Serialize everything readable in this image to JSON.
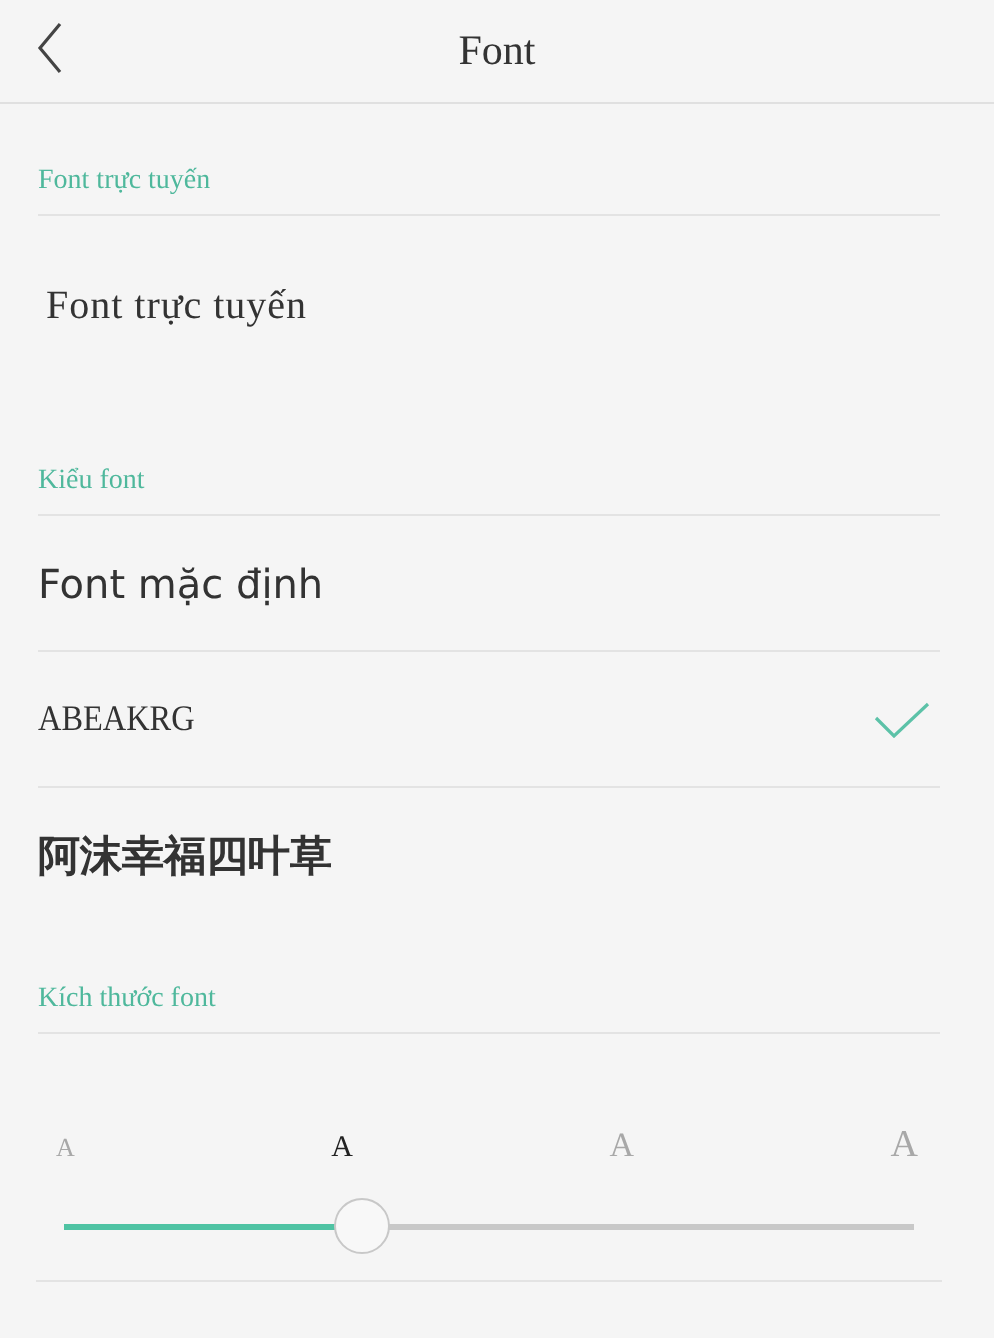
{
  "header": {
    "title": "Font"
  },
  "sections": [
    {
      "title": "Font trực tuyến",
      "kind": "link",
      "items": [
        {
          "label": "Font trực tuyến"
        }
      ]
    },
    {
      "title": "Kiểu font",
      "kind": "fonts",
      "items": [
        {
          "label": "Font mặc định",
          "kind": "sans",
          "selected": false
        },
        {
          "label": "ABEAKRG",
          "kind": "serif",
          "selected": true
        },
        {
          "label": "阿沫幸福四叶草",
          "kind": "cjk",
          "selected": false
        }
      ]
    },
    {
      "title": "Kích thước font",
      "kind": "size",
      "sizes": [
        {
          "label": "A",
          "selected": false
        },
        {
          "label": "A",
          "selected": true
        },
        {
          "label": "A",
          "selected": false
        },
        {
          "label": "A",
          "selected": false
        }
      ],
      "level": 0.33
    }
  ]
}
